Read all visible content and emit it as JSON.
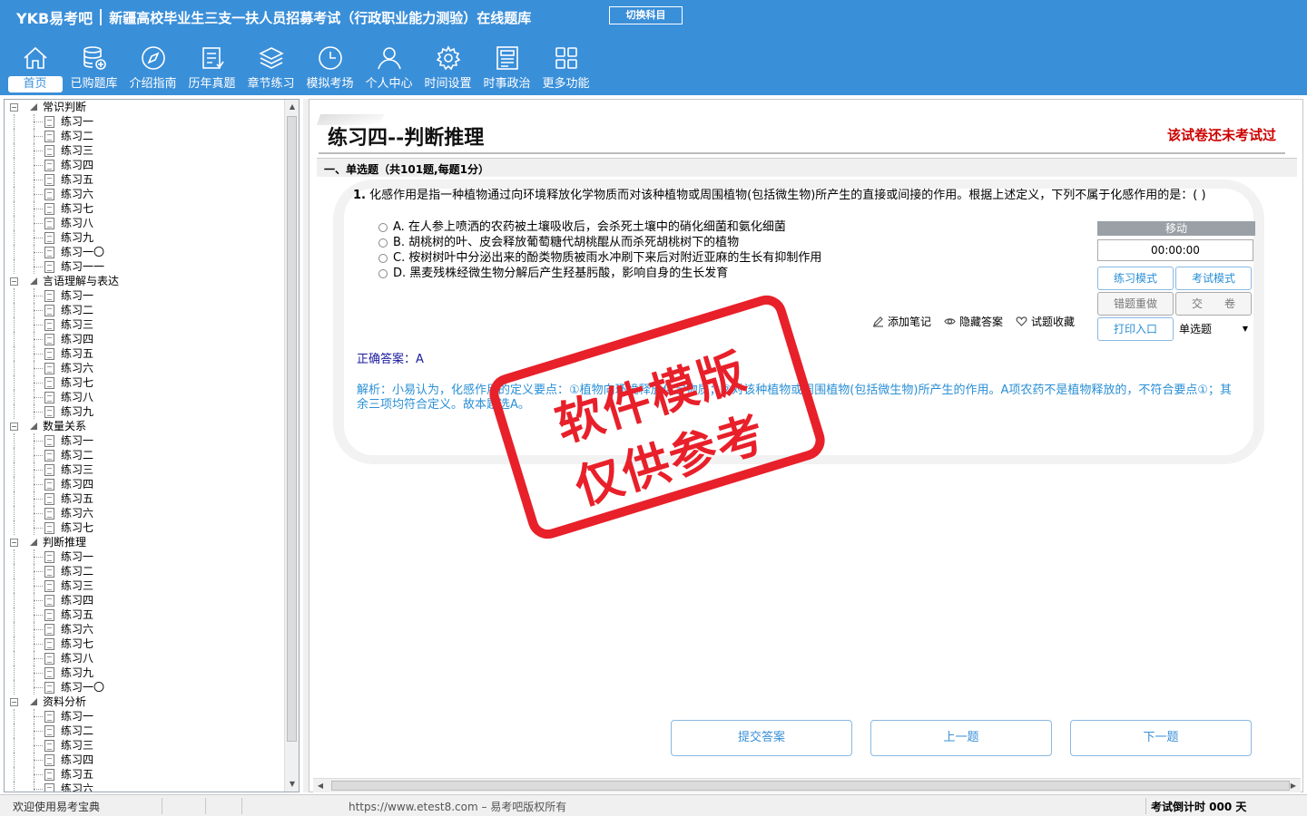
{
  "header": {
    "logo": "YKB易考吧",
    "exam_title": "新疆高校毕业生三支一扶人员招募考试（行政职业能力测验）在线题库",
    "switch_label": "切换科目"
  },
  "nav": [
    {
      "label": "首页",
      "icon": "home-icon"
    },
    {
      "label": "已购题库",
      "icon": "database-icon"
    },
    {
      "label": "介绍指南",
      "icon": "compass-icon"
    },
    {
      "label": "历年真题",
      "icon": "checklist-icon"
    },
    {
      "label": "章节练习",
      "icon": "layers-icon"
    },
    {
      "label": "模拟考场",
      "icon": "clock-icon"
    },
    {
      "label": "个人中心",
      "icon": "user-icon"
    },
    {
      "label": "时间设置",
      "icon": "gear-icon"
    },
    {
      "label": "时事政治",
      "icon": "newspaper-icon"
    },
    {
      "label": "更多功能",
      "icon": "grid-icon"
    }
  ],
  "tree": [
    {
      "category": "常识判断",
      "items": [
        "练习一",
        "练习二",
        "练习三",
        "练习四",
        "练习五",
        "练习六",
        "练习七",
        "练习八",
        "练习九",
        "练习一〇",
        "练习一一"
      ]
    },
    {
      "category": "言语理解与表达",
      "items": [
        "练习一",
        "练习二",
        "练习三",
        "练习四",
        "练习五",
        "练习六",
        "练习七",
        "练习八",
        "练习九"
      ]
    },
    {
      "category": "数量关系",
      "items": [
        "练习一",
        "练习二",
        "练习三",
        "练习四",
        "练习五",
        "练习六",
        "练习七"
      ]
    },
    {
      "category": "判断推理",
      "items": [
        "练习一",
        "练习二",
        "练习三",
        "练习四",
        "练习五",
        "练习六",
        "练习七",
        "练习八",
        "练习九",
        "练习一〇"
      ]
    },
    {
      "category": "资料分析",
      "items": [
        "练习一",
        "练习二",
        "练习三",
        "练习四",
        "练习五",
        "练习六"
      ]
    }
  ],
  "main": {
    "exercise_title": "练习四--判断推理",
    "exam_status": "该试卷还未考试过",
    "section_title": "一、单选题（共101题,每题1分）",
    "question_number": "1.",
    "question_text": "化感作用是指一种植物通过向环境释放化学物质而对该种植物或周围植物(包括微生物)所产生的直接或间接的作用。根据上述定义，下列不属于化感作用的是：( )",
    "options": [
      "A. 在人参上喷洒的农药被土壤吸收后，会杀死土壤中的硝化细菌和氨化细菌",
      "B. 胡桃树的叶、皮会释放葡萄糖代胡桃醌从而杀死胡桃树下的植物",
      "C. 桉树树叶中分泌出来的酚类物质被雨水冲刷下来后对附近亚麻的生长有抑制作用",
      "D. 黑麦残株经微生物分解后产生羟基肟酸，影响自身的生长发育"
    ],
    "tools": {
      "add_note": "添加笔记",
      "hide_answer": "隐藏答案",
      "favorite": "试题收藏"
    },
    "answer": "正确答案：A",
    "explanation": "解析：小易认为，化感作用的定义要点：①植物向环境释放化学物质；②对该种植物或周围植物(包括微生物)所产生的作用。A项农药不是植物释放的，不符合要点①；其余三项均符合定义。故本题选A。"
  },
  "timer_panel": {
    "move_label": "移动",
    "time": "00:00:00",
    "practice_mode": "练习模式",
    "exam_mode": "考试模式",
    "redo_wrong": "错题重做",
    "submit_paper": "交　　卷",
    "print": "打印入口",
    "question_type": "单选题"
  },
  "watermark": {
    "line1": "软件模版",
    "line2": "仅供参考"
  },
  "actions": {
    "submit": "提交答案",
    "prev": "上一题",
    "next": "下一题"
  },
  "statusbar": {
    "welcome": "欢迎使用易考宝典",
    "copyright": "https://www.etest8.com – 易考吧版权所有",
    "countdown": "考试倒计时 000 天"
  },
  "colors": {
    "header_bg": "#3a8fd9",
    "status_red": "#cc0000",
    "explanation_blue": "#2a8fd6",
    "stamp_red": "#e8202a"
  }
}
